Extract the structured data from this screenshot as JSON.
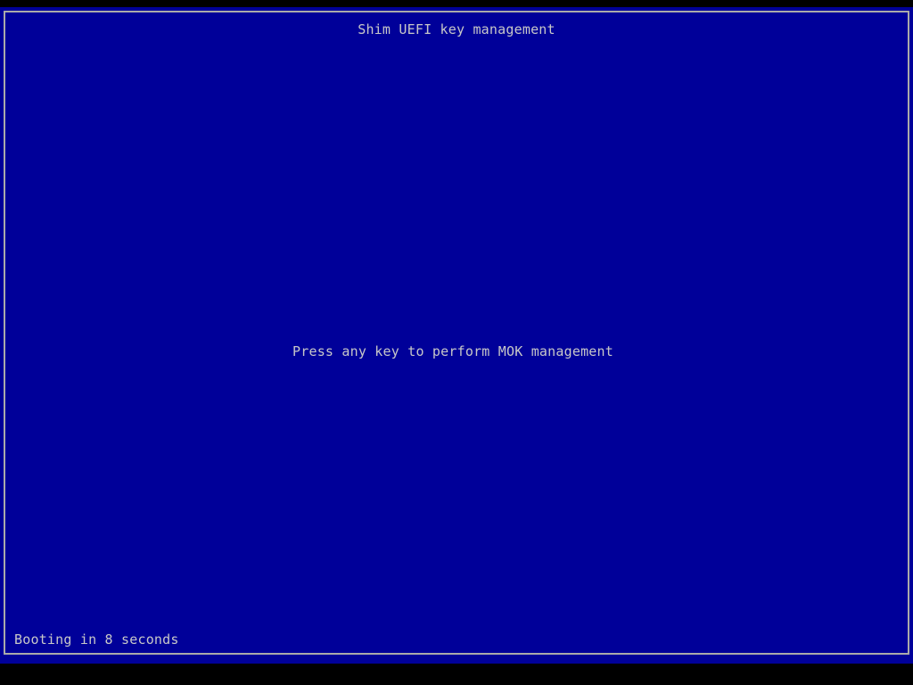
{
  "screen": {
    "title": "Shim UEFI key management",
    "prompt": "Press any key to perform MOK management",
    "countdown": "Booting in 8 seconds"
  },
  "colors": {
    "background": "#000099",
    "border": "#aaaaaa",
    "text": "#c8c8c8",
    "outer": "#000000"
  }
}
